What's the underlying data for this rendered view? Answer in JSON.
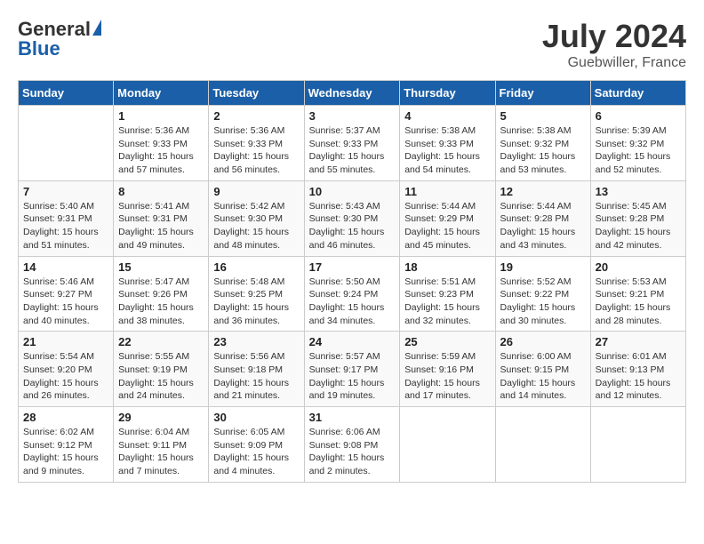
{
  "header": {
    "logo_general": "General",
    "logo_blue": "Blue",
    "title": "July 2024",
    "subtitle": "Guebwiller, France"
  },
  "days_of_week": [
    "Sunday",
    "Monday",
    "Tuesday",
    "Wednesday",
    "Thursday",
    "Friday",
    "Saturday"
  ],
  "weeks": [
    [
      {
        "day": "",
        "info": ""
      },
      {
        "day": "1",
        "info": "Sunrise: 5:36 AM\nSunset: 9:33 PM\nDaylight: 15 hours\nand 57 minutes."
      },
      {
        "day": "2",
        "info": "Sunrise: 5:36 AM\nSunset: 9:33 PM\nDaylight: 15 hours\nand 56 minutes."
      },
      {
        "day": "3",
        "info": "Sunrise: 5:37 AM\nSunset: 9:33 PM\nDaylight: 15 hours\nand 55 minutes."
      },
      {
        "day": "4",
        "info": "Sunrise: 5:38 AM\nSunset: 9:33 PM\nDaylight: 15 hours\nand 54 minutes."
      },
      {
        "day": "5",
        "info": "Sunrise: 5:38 AM\nSunset: 9:32 PM\nDaylight: 15 hours\nand 53 minutes."
      },
      {
        "day": "6",
        "info": "Sunrise: 5:39 AM\nSunset: 9:32 PM\nDaylight: 15 hours\nand 52 minutes."
      }
    ],
    [
      {
        "day": "7",
        "info": "Sunrise: 5:40 AM\nSunset: 9:31 PM\nDaylight: 15 hours\nand 51 minutes."
      },
      {
        "day": "8",
        "info": "Sunrise: 5:41 AM\nSunset: 9:31 PM\nDaylight: 15 hours\nand 49 minutes."
      },
      {
        "day": "9",
        "info": "Sunrise: 5:42 AM\nSunset: 9:30 PM\nDaylight: 15 hours\nand 48 minutes."
      },
      {
        "day": "10",
        "info": "Sunrise: 5:43 AM\nSunset: 9:30 PM\nDaylight: 15 hours\nand 46 minutes."
      },
      {
        "day": "11",
        "info": "Sunrise: 5:44 AM\nSunset: 9:29 PM\nDaylight: 15 hours\nand 45 minutes."
      },
      {
        "day": "12",
        "info": "Sunrise: 5:44 AM\nSunset: 9:28 PM\nDaylight: 15 hours\nand 43 minutes."
      },
      {
        "day": "13",
        "info": "Sunrise: 5:45 AM\nSunset: 9:28 PM\nDaylight: 15 hours\nand 42 minutes."
      }
    ],
    [
      {
        "day": "14",
        "info": "Sunrise: 5:46 AM\nSunset: 9:27 PM\nDaylight: 15 hours\nand 40 minutes."
      },
      {
        "day": "15",
        "info": "Sunrise: 5:47 AM\nSunset: 9:26 PM\nDaylight: 15 hours\nand 38 minutes."
      },
      {
        "day": "16",
        "info": "Sunrise: 5:48 AM\nSunset: 9:25 PM\nDaylight: 15 hours\nand 36 minutes."
      },
      {
        "day": "17",
        "info": "Sunrise: 5:50 AM\nSunset: 9:24 PM\nDaylight: 15 hours\nand 34 minutes."
      },
      {
        "day": "18",
        "info": "Sunrise: 5:51 AM\nSunset: 9:23 PM\nDaylight: 15 hours\nand 32 minutes."
      },
      {
        "day": "19",
        "info": "Sunrise: 5:52 AM\nSunset: 9:22 PM\nDaylight: 15 hours\nand 30 minutes."
      },
      {
        "day": "20",
        "info": "Sunrise: 5:53 AM\nSunset: 9:21 PM\nDaylight: 15 hours\nand 28 minutes."
      }
    ],
    [
      {
        "day": "21",
        "info": "Sunrise: 5:54 AM\nSunset: 9:20 PM\nDaylight: 15 hours\nand 26 minutes."
      },
      {
        "day": "22",
        "info": "Sunrise: 5:55 AM\nSunset: 9:19 PM\nDaylight: 15 hours\nand 24 minutes."
      },
      {
        "day": "23",
        "info": "Sunrise: 5:56 AM\nSunset: 9:18 PM\nDaylight: 15 hours\nand 21 minutes."
      },
      {
        "day": "24",
        "info": "Sunrise: 5:57 AM\nSunset: 9:17 PM\nDaylight: 15 hours\nand 19 minutes."
      },
      {
        "day": "25",
        "info": "Sunrise: 5:59 AM\nSunset: 9:16 PM\nDaylight: 15 hours\nand 17 minutes."
      },
      {
        "day": "26",
        "info": "Sunrise: 6:00 AM\nSunset: 9:15 PM\nDaylight: 15 hours\nand 14 minutes."
      },
      {
        "day": "27",
        "info": "Sunrise: 6:01 AM\nSunset: 9:13 PM\nDaylight: 15 hours\nand 12 minutes."
      }
    ],
    [
      {
        "day": "28",
        "info": "Sunrise: 6:02 AM\nSunset: 9:12 PM\nDaylight: 15 hours\nand 9 minutes."
      },
      {
        "day": "29",
        "info": "Sunrise: 6:04 AM\nSunset: 9:11 PM\nDaylight: 15 hours\nand 7 minutes."
      },
      {
        "day": "30",
        "info": "Sunrise: 6:05 AM\nSunset: 9:09 PM\nDaylight: 15 hours\nand 4 minutes."
      },
      {
        "day": "31",
        "info": "Sunrise: 6:06 AM\nSunset: 9:08 PM\nDaylight: 15 hours\nand 2 minutes."
      },
      {
        "day": "",
        "info": ""
      },
      {
        "day": "",
        "info": ""
      },
      {
        "day": "",
        "info": ""
      }
    ]
  ]
}
